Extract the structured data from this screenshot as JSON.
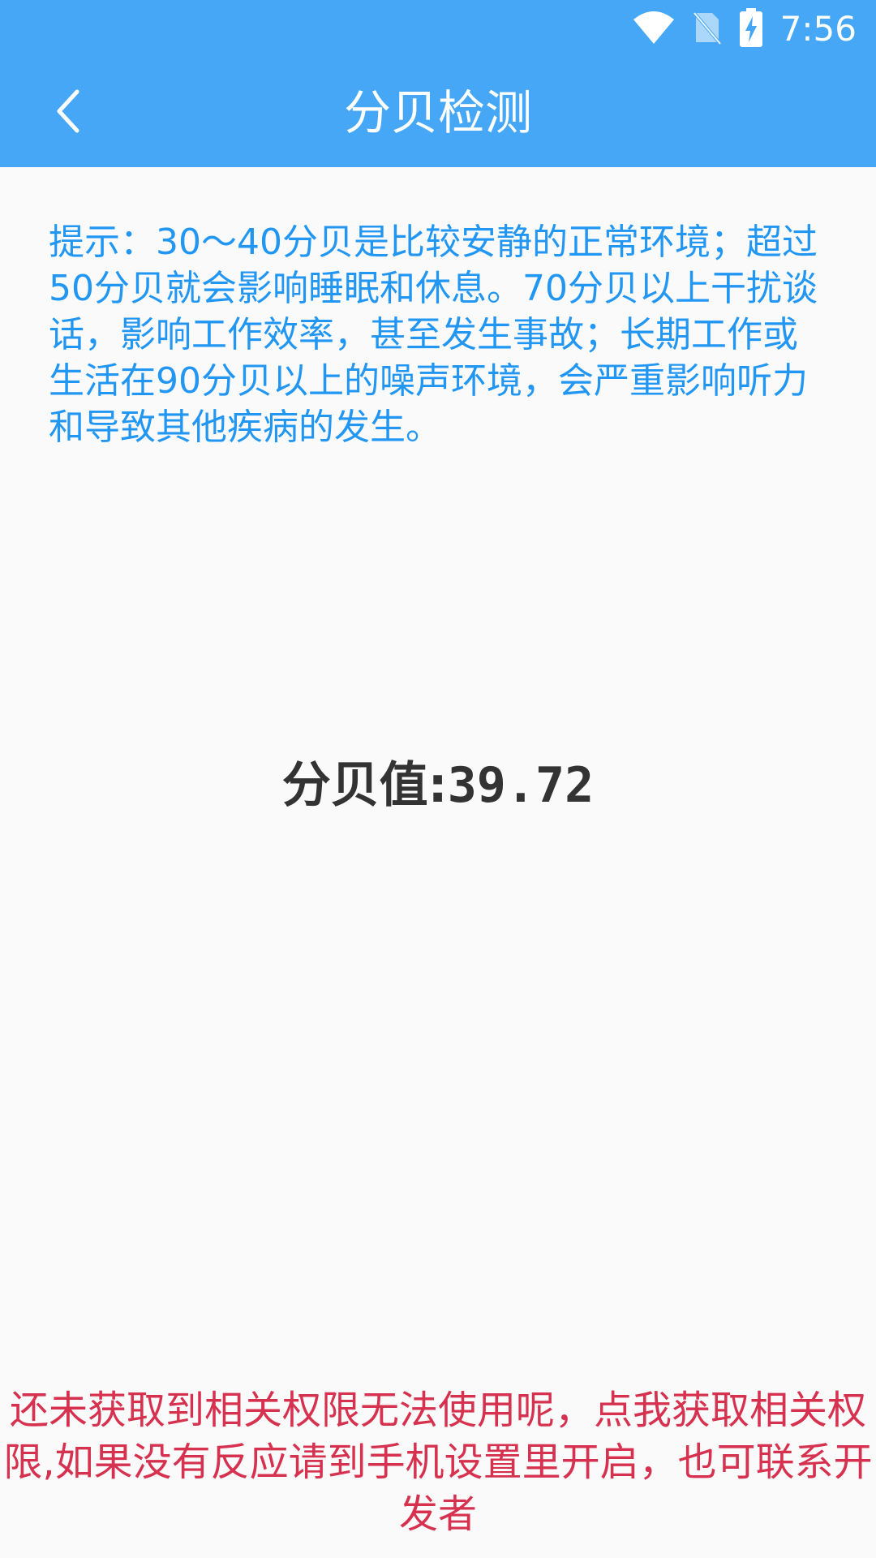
{
  "status_bar": {
    "time": "7:56",
    "icons": [
      "wifi-icon",
      "no-sim-icon",
      "battery-charging-icon"
    ]
  },
  "app_bar": {
    "back_icon": "chevron-left-icon",
    "title": "分贝检测",
    "background": "#45a7f5"
  },
  "tip": {
    "text": "提示：30～40分贝是比较安静的正常环境；超过50分贝就会影响睡眠和休息。70分贝以上干扰谈话，影响工作效率，甚至发生事故；长期工作或生活在90分贝以上的噪声环境，会严重影响听力和导致其他疾病的发生。",
    "color": "#2196f3"
  },
  "decibel": {
    "label": "分贝值:",
    "value": "39.72"
  },
  "permission_notice": {
    "text": "还未获取到相关权限无法使用呢，点我获取相关权限,如果没有反应请到手机设置里开启，也可联系开发者",
    "color": "#d6314f"
  }
}
